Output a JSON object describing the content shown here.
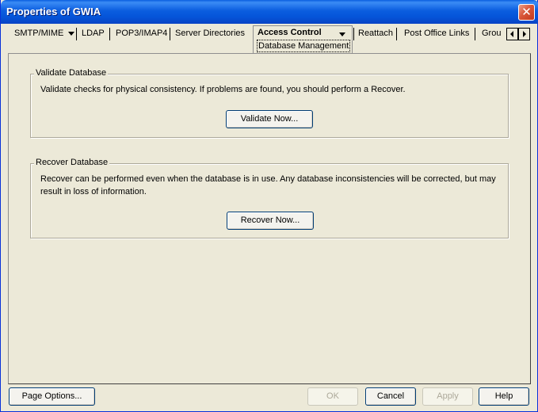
{
  "window": {
    "title": "Properties of GWIA",
    "close_glyph": "✕"
  },
  "tabs": {
    "items": [
      {
        "label": "SMTP/MIME",
        "has_dropdown": true
      },
      {
        "label": "LDAP"
      },
      {
        "label": "POP3/IMAP4"
      },
      {
        "label": "Server Directories"
      },
      {
        "label": "Reattach"
      },
      {
        "label": "Post Office Links"
      },
      {
        "label": "Grou"
      }
    ],
    "active": {
      "label": "Access Control",
      "sub_label": "Database Management",
      "has_dropdown": true
    }
  },
  "validate_group": {
    "title": "Validate Database",
    "description": "Validate checks for physical consistency. If problems are found, you should perform a Recover.",
    "button_label": "Validate Now..."
  },
  "recover_group": {
    "title": "Recover Database",
    "description_line1": "Recover can be performed even when the database is in use. Any database inconsistencies will be corrected, but may",
    "description_line2": "result in loss of information.",
    "button_label": "Recover Now..."
  },
  "footer": {
    "page_options": "Page Options...",
    "ok": "OK",
    "cancel": "Cancel",
    "apply": "Apply",
    "help": "Help"
  }
}
